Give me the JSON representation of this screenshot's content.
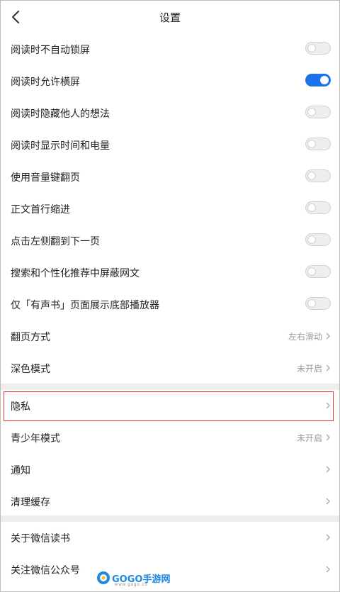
{
  "header": {
    "title": "设置"
  },
  "toggles": [
    {
      "label": "阅读时不自动锁屏",
      "on": false
    },
    {
      "label": "阅读时允许横屏",
      "on": true
    },
    {
      "label": "阅读时隐藏他人的想法",
      "on": false
    },
    {
      "label": "阅读时显示时间和电量",
      "on": false
    },
    {
      "label": "使用音量键翻页",
      "on": false
    },
    {
      "label": "正文首行缩进",
      "on": false
    },
    {
      "label": "点击左侧翻到下一页",
      "on": false
    },
    {
      "label": "搜索和个性化推荐中屏蔽网文",
      "on": false
    },
    {
      "label": "仅「有声书」页面展示底部播放器",
      "on": false
    }
  ],
  "page_turn": {
    "label": "翻页方式",
    "value": "左右滑动"
  },
  "dark_mode": {
    "label": "深色模式",
    "value": "未开启"
  },
  "privacy": {
    "label": "隐私"
  },
  "youth_mode": {
    "label": "青少年模式",
    "value": "未开启"
  },
  "notifications": {
    "label": "通知"
  },
  "clear_cache": {
    "label": "清理缓存"
  },
  "about": {
    "label": "关于微信读书"
  },
  "follow": {
    "label": "关注微信公众号"
  },
  "watermark": {
    "text": "GOGO手游网",
    "sub": "www.gogo.cn"
  },
  "colors": {
    "accent": "#1a73e8",
    "highlight": "#e53935",
    "divider": "#eeeeee"
  }
}
